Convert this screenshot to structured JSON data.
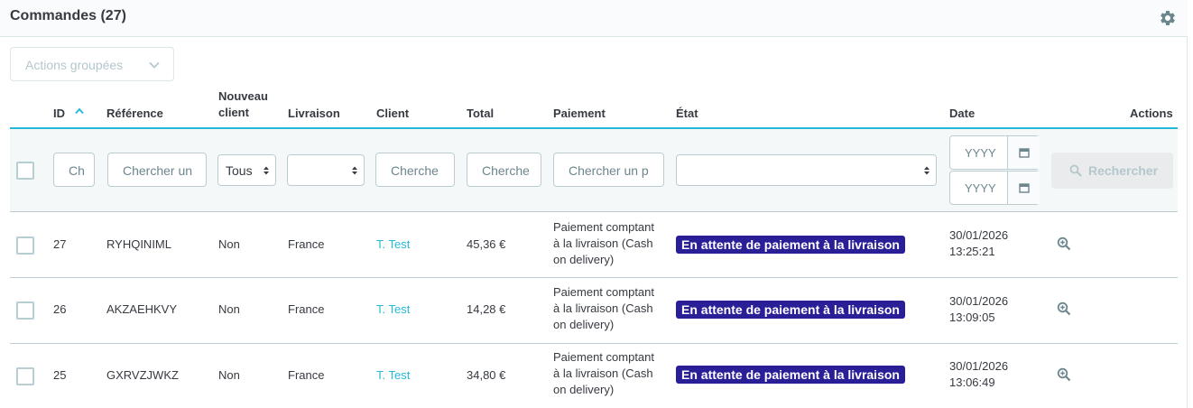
{
  "panel": {
    "title": "Commandes (27)",
    "settings_icon": "gear-icon"
  },
  "bulk_actions": {
    "label": "Actions groupées",
    "icon": "chevron-down-icon"
  },
  "columns": {
    "id": "ID",
    "reference": "Référence",
    "new_client_line1": "Nouveau",
    "new_client_line2": "client",
    "delivery": "Livraison",
    "client": "Client",
    "total": "Total",
    "payment": "Paiement",
    "state": "État",
    "date": "Date",
    "actions": "Actions"
  },
  "sort": {
    "column": "id",
    "direction": "asc",
    "icon": "sort-up-icon"
  },
  "filters": {
    "id_placeholder": "Ch",
    "reference_placeholder": "Chercher un",
    "new_client_value": "Tous",
    "delivery_value": "",
    "client_placeholder": "Cherche",
    "total_placeholder": "Cherche",
    "payment_placeholder": "Chercher un p",
    "state_value": "",
    "date_from_placeholder": "YYYY",
    "date_to_placeholder": "YYYY",
    "search_label": "Rechercher"
  },
  "rows": [
    {
      "id": "27",
      "reference": "RYHQINIML",
      "new_client": "Non",
      "delivery": "France",
      "client": "T. Test",
      "total": "45,36 €",
      "payment_line1": "Paiement comptant",
      "payment_line2": "à la livraison (Cash",
      "payment_line3": "on delivery)",
      "state": "En attente de paiement à la livraison",
      "state_color": "#2a1f97",
      "date_line1": "30/01/2026",
      "date_line2": "13:25:21"
    },
    {
      "id": "26",
      "reference": "AKZAEHKVY",
      "new_client": "Non",
      "delivery": "France",
      "client": "T. Test",
      "total": "14,28 €",
      "payment_line1": "Paiement comptant",
      "payment_line2": "à la livraison (Cash",
      "payment_line3": "on delivery)",
      "state": "En attente de paiement à la livraison",
      "state_color": "#2a1f97",
      "date_line1": "30/01/2026",
      "date_line2": "13:09:05"
    },
    {
      "id": "25",
      "reference": "GXRVZJWKZ",
      "new_client": "Non",
      "delivery": "France",
      "client": "T. Test",
      "total": "34,80 €",
      "payment_line1": "Paiement comptant",
      "payment_line2": "à la livraison (Cash",
      "payment_line3": "on delivery)",
      "state": "En attente de paiement à la livraison",
      "state_color": "#2a1f97",
      "date_line1": "30/01/2026",
      "date_line2": "13:06:49"
    }
  ],
  "colors": {
    "accent": "#25b9d7",
    "text": "#363a41",
    "border": "#bbcdd2"
  }
}
